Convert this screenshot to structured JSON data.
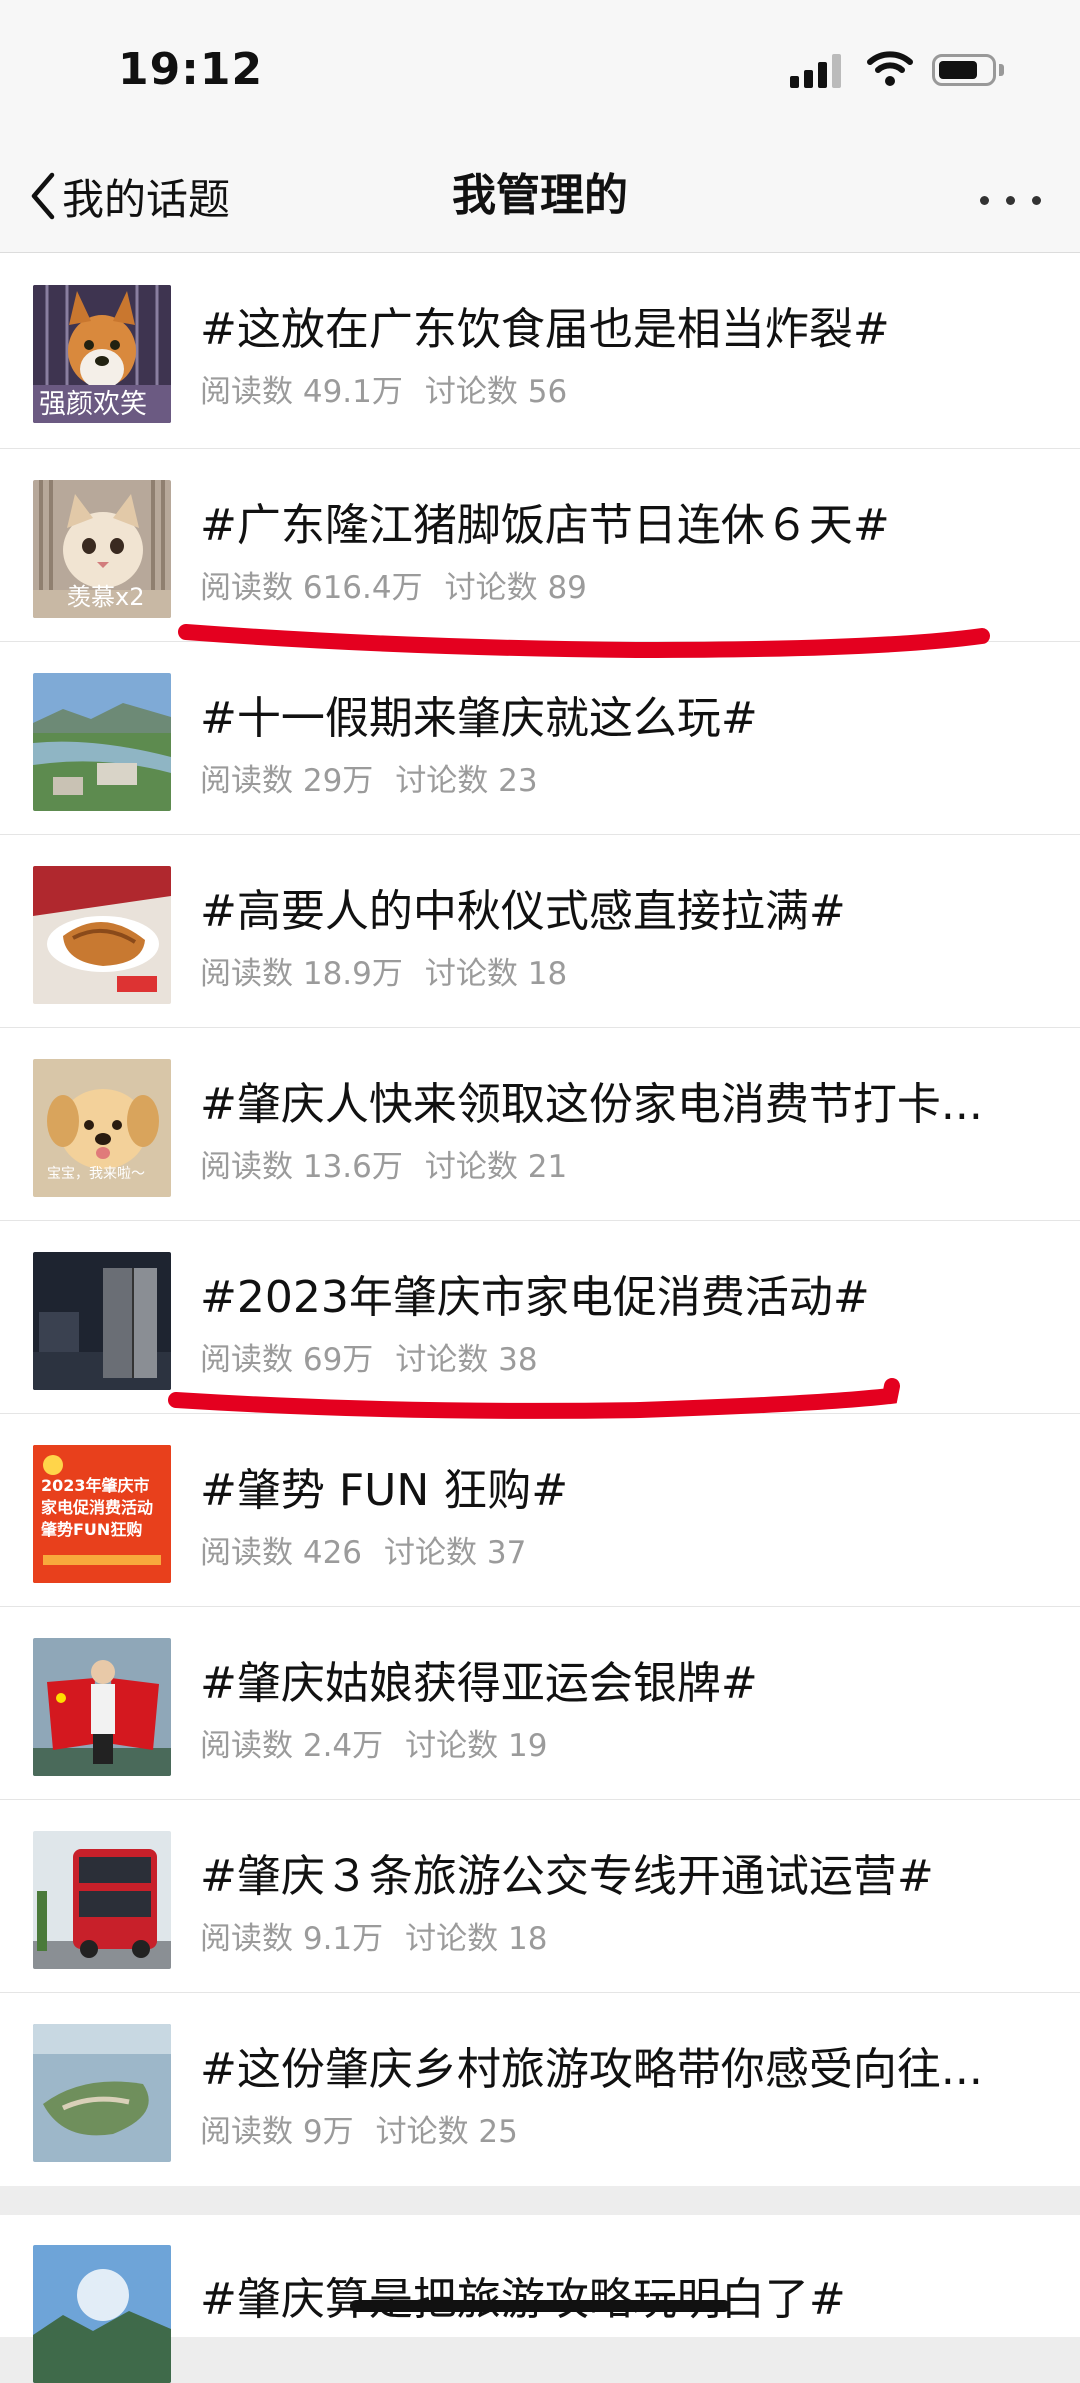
{
  "status_bar": {
    "time": "19:12",
    "battery_level": 0.75
  },
  "nav": {
    "back_label": "我的话题",
    "title": "我管理的"
  },
  "topics": [
    {
      "title": "#这放在广东饮食届也是相当炸裂#",
      "reads": "阅读数 49.1万",
      "comments": "讨论数 56",
      "thumb_caption": "强颜欢笑"
    },
    {
      "title": "#广东隆江猪脚饭店节日连休６天#",
      "reads": "阅读数 616.4万",
      "comments": "讨论数 89",
      "thumb_caption": "羡慕x2"
    },
    {
      "title": "#十一假期来肇庆就这么玩#",
      "reads": "阅读数 29万",
      "comments": "讨论数 23"
    },
    {
      "title": "#高要人的中秋仪式感直接拉满#",
      "reads": "阅读数 18.9万",
      "comments": "讨论数 18"
    },
    {
      "title": "#肇庆人快来领取这份家电消费节打卡...",
      "reads": "阅读数 13.6万",
      "comments": "讨论数 21",
      "thumb_caption": "宝宝，我来啦～"
    },
    {
      "title": "#2023年肇庆市家电促消费活动#",
      "reads": "阅读数 69万",
      "comments": "讨论数 38"
    },
    {
      "title": "#肇势 FUN 狂购#",
      "reads": "阅读数 426",
      "comments": "讨论数 37",
      "thumb_caption": "2023年肇庆市 家电促消费活动 肇势FUN狂购"
    },
    {
      "title": "#肇庆姑娘获得亚运会银牌#",
      "reads": "阅读数 2.4万",
      "comments": "讨论数 19"
    },
    {
      "title": "#肇庆３条旅游公交专线开通试运营#",
      "reads": "阅读数 9.1万",
      "comments": "讨论数 18"
    },
    {
      "title": "#这份肇庆乡村旅游攻略带你感受向往...",
      "reads": "阅读数 9万",
      "comments": "讨论数 25"
    }
  ],
  "last_topic": {
    "title": "#肇庆算是把旅游攻略玩明白了#"
  },
  "colors": {
    "annotation_red": "#e4001f",
    "meta_gray": "#9b9b9b"
  }
}
